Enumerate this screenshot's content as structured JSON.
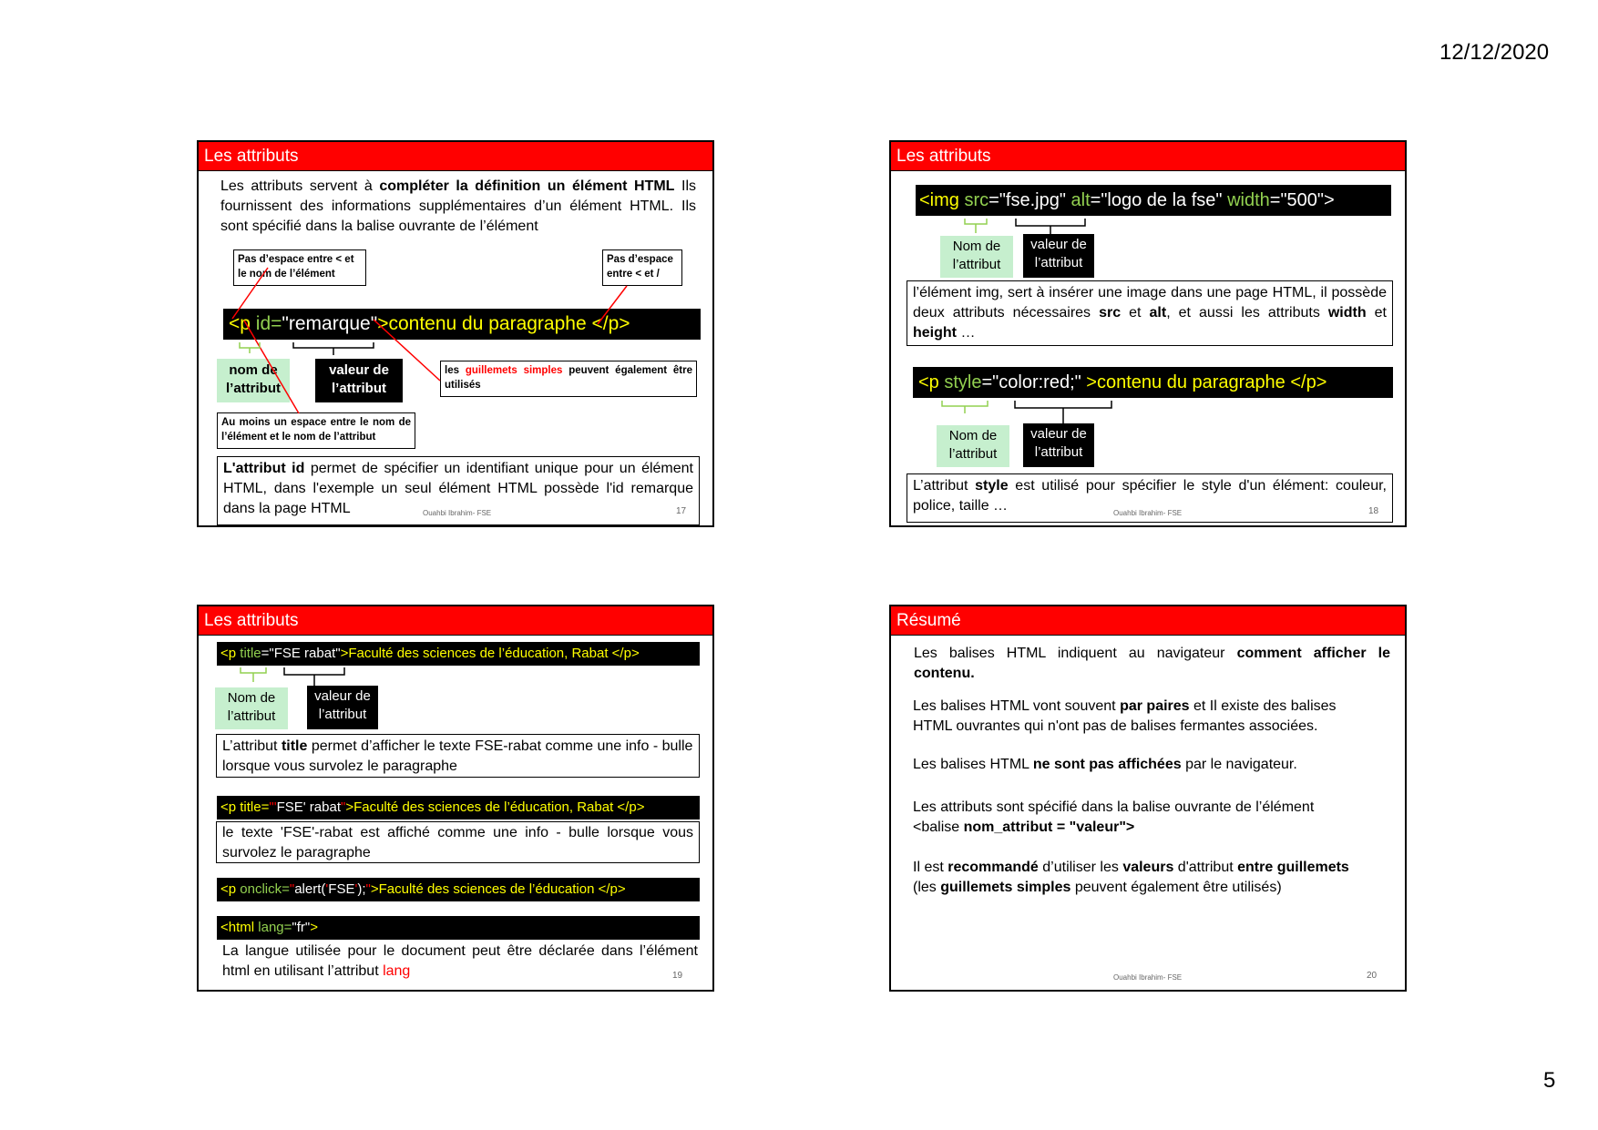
{
  "date": "12/12/2020",
  "page_number": "5",
  "footer": "Ouahbi Ibrahim- FSE",
  "slide17": {
    "title": "Les attributs",
    "intro_1": "Les attributs servent à ",
    "intro_bold": "compléter la définition un élément HTML",
    "intro_2": " Ils fournissent des informations supplémentaires d’un élément HTML. Ils sont spécifié dans la balise ouvrante de l’élément",
    "note_left": "Pas d’espace entre < et le nom de l’élément",
    "note_right": "Pas d’espace entre < et /",
    "code_open": "<p",
    "code_attr": "id=",
    "code_val": "\"remarque\"",
    "code_rest": ">contenu du paragraphe </p>",
    "label_name": "nom de l’attribut",
    "label_value": "valeur de l’attribut",
    "quotes_1": "les ",
    "quotes_red": "guillemets simples",
    "quotes_2": " peuvent également être utilisés",
    "space_note": "Au moins un espace entre le nom de l’élément et le nom de l’attribut",
    "id_bold": "L'attribut id",
    "id_text": " permet de spécifier un identifiant unique pour un élément HTML, dans l'exemple un seul élément HTML possède l'id remarque dans la page HTML",
    "num": "17"
  },
  "slide18": {
    "title": "Les attributs",
    "img_1": "<img ",
    "img_src": "src",
    "img_eq1": "=\"fse.jpg\"  ",
    "img_alt": "alt",
    "img_eq2": "=\"logo de la fse\" ",
    "img_width": "width",
    "img_eq3": "=\"500\">",
    "label_name": "Nom de l’attribut",
    "label_value": "valeur de l’attribut",
    "desc_1": "l’élément img, sert à insérer une image dans une page HTML, il possède deux attributs nécessaires  ",
    "desc_src": "src",
    "desc_et": " et ",
    "desc_alt": "alt",
    "desc_2": ", et aussi les attributs ",
    "desc_width": "width",
    "desc_et2": " et ",
    "desc_height": "height",
    "desc_3": " …",
    "style_1": "<p ",
    "style_attr": "style",
    "style_val": "=\"color:red;\"",
    "style_rest": " >contenu du paragraphe </p>",
    "style_desc_1": "L’attribut ",
    "style_desc_bold": "style",
    "style_desc_2": " est utilisé pour spécifier le style d'un élément: couleur, police, taille …",
    "num": "18"
  },
  "slide19": {
    "title": "Les attributs",
    "c1_open": "<p ",
    "c1_attr": "title",
    "c1_val": "=\"FSE rabat\"",
    "c1_rest": ">Faculté des sciences de l’éducation, Rabat </p>",
    "label_name": "Nom de l’attribut",
    "label_value": "valeur de l’attribut",
    "t1_1": "L’attribut ",
    "t1_bold": "title",
    "t1_2": " permet d’afficher le texte FSE-rabat comme une info - bulle lorsque vous survolez le paragraphe",
    "c2_open": "<p title=",
    "c2_q1": "\"'",
    "c2_fse": "FSE",
    "c2_q2": "' rabat",
    "c2_q3": "\"",
    "c2_rest": ">Faculté des sciences de l’éducation, Rabat </p>",
    "t2": "le texte 'FSE'-rabat est affiché comme une info - bulle lorsque vous survolez le paragraphe",
    "c3_open": "<p ",
    "c3_attr": "onclick=",
    "c3_q1": "\"",
    "c3_alert": "alert(",
    "c3_arg1": "'",
    "c3_fse": "FSE",
    "c3_arg2": "'",
    "c3_close": ");",
    "c3_q2": "\"",
    "c3_rest": ">Faculté des sciences de l’éducation </p>",
    "c4_open": "<html ",
    "c4_attr": "lang=",
    "c4_val": "\"fr\"",
    "c4_close": ">",
    "t3_1": "La langue utilisée pour le document peut être déclarée dans l’élément html  en utilisant l’attribut ",
    "t3_red": "lang",
    "num": "19"
  },
  "slide20": {
    "title": "Résumé",
    "p1_1": "Les balises HTML indiquent au navigateur ",
    "p1_bold": "comment afficher le contenu.",
    "p2_1": "Les balises HTML vont souvent ",
    "p2_bold": "par paires",
    "p2_2": " et Il existe des balises HTML ouvrantes qui n'ont pas de balises fermantes associées.",
    "p3_1": "Les balises HTML ",
    "p3_bold": "ne sont pas affichées",
    "p3_2": " par le navigateur.",
    "p4_1": "Les attributs sont spécifié dans la balise ouvrante de l’élément",
    "p4_2": "<balise ",
    "p4_bold": "nom_attribut = \"valeur\">",
    "p5_1": "Il est ",
    "p5_b1": "recommandé",
    "p5_2": " d’utiliser les ",
    "p5_b2": "valeurs",
    "p5_3": " d'attribut ",
    "p5_b3": "entre guillemets",
    "p5_4": "(les ",
    "p5_b4": "guillemets simples",
    "p5_5": " peuvent également être utilisés)",
    "num": "20"
  }
}
